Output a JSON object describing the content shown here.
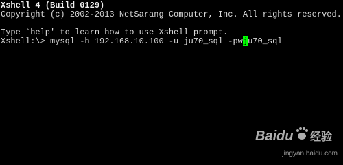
{
  "terminal": {
    "header_line": "Xshell 4 (Build 0129)",
    "copyright_line": "Copyright (c) 2002-2013 NetSarang Computer, Inc. All rights reserved.",
    "help_line": "Type `help' to learn how to use Xshell prompt.",
    "prompt": "Xshell:\\> ",
    "command_before_cursor": "mysql -h 192.168.10.100 -u ju70_sql -pw",
    "cursor_char": "j",
    "command_after_cursor": "u70_sql"
  },
  "watermark": {
    "brand": "Baidu",
    "label": "经验",
    "url": "jingyan.baidu.com"
  },
  "colors": {
    "background": "#000000",
    "text": "#d8d8d8",
    "cursor": "#00ff00"
  }
}
